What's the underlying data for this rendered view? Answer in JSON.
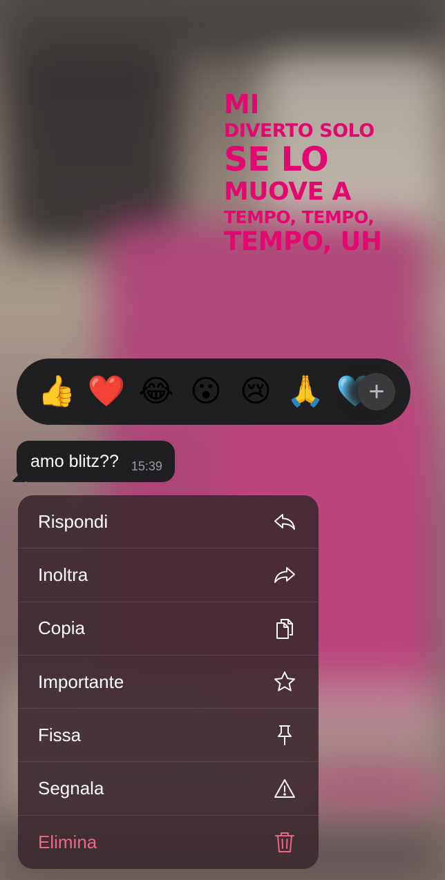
{
  "lyrics": {
    "line1": "MI",
    "line2": "DIVERTO SOLO",
    "line3": "SE LO",
    "line4": "MUOVE A",
    "line5": "TEMPO, TEMPO,",
    "line6": "TEMPO, UH",
    "color": "#e2086f"
  },
  "reactions": {
    "emojis": [
      "👍",
      "❤️",
      "😂",
      "😮",
      "😢",
      "🙏",
      "🩵"
    ],
    "more_label": "+"
  },
  "message": {
    "text": "amo blitz??",
    "time": "15:39"
  },
  "menu": {
    "items": [
      {
        "label": "Rispondi",
        "icon": "reply-icon"
      },
      {
        "label": "Inoltra",
        "icon": "forward-icon"
      },
      {
        "label": "Copia",
        "icon": "copy-icon"
      },
      {
        "label": "Importante",
        "icon": "star-icon"
      },
      {
        "label": "Fissa",
        "icon": "pin-icon"
      },
      {
        "label": "Segnala",
        "icon": "warning-icon"
      },
      {
        "label": "Elimina",
        "icon": "trash-icon"
      }
    ],
    "danger_color": "#f06688"
  }
}
